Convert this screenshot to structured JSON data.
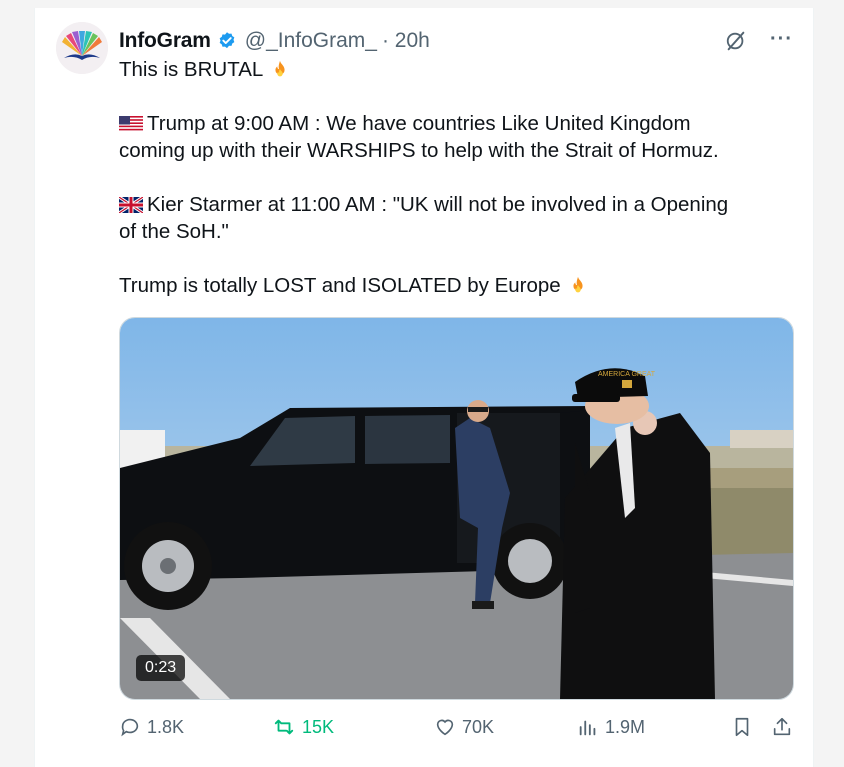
{
  "tweet": {
    "author_name": "InfoGram",
    "handle": "@_InfoGram_",
    "time": "· 20h",
    "lines": {
      "l1": "This is BRUTAL",
      "l2": "Trump at 9:00 AM : We have countries Like United Kingdom",
      "l3": "coming up with their WARSHIPS to help with the Strait of Hormuz.",
      "l4": "Kier Starmer at 11:00 AM : \"UK will not be involved in a Opening",
      "l5": "of the SoH.\"",
      "l6": "Trump is totally LOST and ISOLATED by Europe"
    },
    "video_duration": "0:23",
    "cap_text": "AMERICA GREAT"
  },
  "actions": {
    "replies": "1.8K",
    "reposts": "15K",
    "likes": "70K",
    "views": "1.9M"
  },
  "colors": {
    "verified": "#1d9bf0",
    "repost": "#00ba7c",
    "muted": "#536471"
  },
  "icons": [
    "verified-badge-icon",
    "grok-icon",
    "more-icon",
    "flame-icon",
    "us-flag-icon",
    "uk-flag-icon",
    "reply-icon",
    "repost-icon",
    "like-icon",
    "views-icon",
    "bookmark-icon",
    "share-icon"
  ]
}
